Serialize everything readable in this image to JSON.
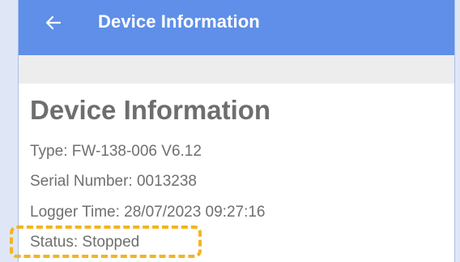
{
  "appbar": {
    "title": "Device Information",
    "back_icon": "arrow-left-icon",
    "color": "#5f8fe8"
  },
  "section": {
    "heading": "Device Information"
  },
  "device": {
    "type": "Type: FW-138-006 V6.12",
    "serial": "Serial Number:  0013238",
    "logger_time": "Logger Time: 28/07/2023 09:27:16",
    "status": "Status: Stopped"
  },
  "highlight": {
    "color": "#f3b51f",
    "target": "status"
  }
}
